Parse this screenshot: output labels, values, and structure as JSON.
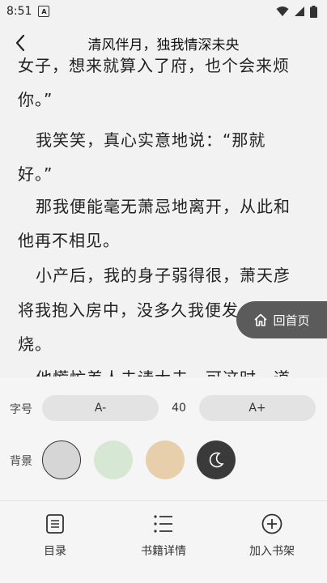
{
  "status": {
    "time": "8:51",
    "a_badge": "A"
  },
  "header": {
    "title": "清风伴月，独我情深未央"
  },
  "reader": {
    "paragraphs": [
      "女子，想来就算入了府，也个会来烦",
      "你。”",
      "我笑笑，真心实意地说：“那就",
      "好。”",
      "那我便能毫无萧忌地离开，从此和",
      "他再不相见。",
      "小产后，我的身子弱得很，萧天彦",
      "将我抱入房中，没多久我便发",
      "烧。",
      "他慌忙差人去请大夫，可这时一道"
    ]
  },
  "home_button": {
    "label": "回首页"
  },
  "settings": {
    "font_label": "字号",
    "decrease_label": "A-",
    "font_size": "40",
    "increase_label": "A+",
    "bg_label": "背景",
    "bg_colors": [
      "#d6d6d6",
      "#d6e8d3",
      "#e8cfab",
      "#3a3a3a"
    ]
  },
  "tabs": [
    {
      "label": "目录",
      "icon": "catalog-icon"
    },
    {
      "label": "书籍详情",
      "icon": "list-icon"
    },
    {
      "label": "加入书架",
      "icon": "add-circle-icon"
    }
  ]
}
